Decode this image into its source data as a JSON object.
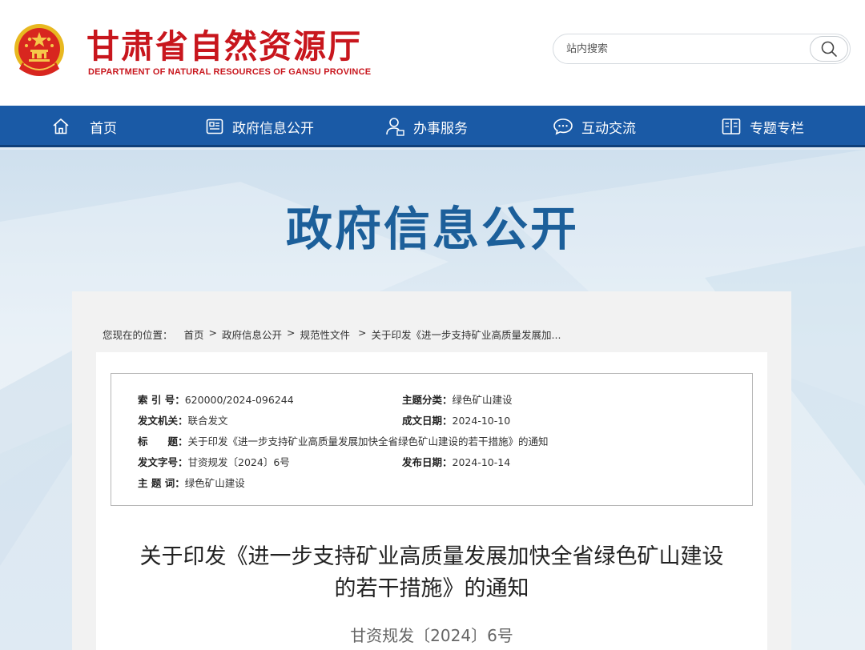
{
  "header": {
    "site_title": "甘肃省自然资源厅",
    "site_subtitle": "DEPARTMENT OF NATURAL RESOURCES OF GANSU PROVINCE",
    "emblem_icon": "national-emblem-icon",
    "search": {
      "placeholder": "站内搜索",
      "value": "",
      "button_icon": "search-icon"
    }
  },
  "nav": {
    "items": [
      {
        "label": "首页",
        "icon": "home-icon"
      },
      {
        "label": "政府信息公开",
        "icon": "document-icon"
      },
      {
        "label": "办事服务",
        "icon": "user-service-icon"
      },
      {
        "label": "互动交流",
        "icon": "chat-icon"
      },
      {
        "label": "专题专栏",
        "icon": "book-icon"
      }
    ]
  },
  "banner": {
    "title": "政府信息公开"
  },
  "breadcrumb": {
    "prefix": "您现在的位置：",
    "items": [
      "首页",
      "政府信息公开",
      "规范性文件",
      "关于印发《进一步支持矿业高质量发展加..."
    ]
  },
  "meta": {
    "index_label": "索 引 号：",
    "index_value": "620000/2024-096244",
    "category_label": "主题分类：",
    "category_value": "绿色矿山建设",
    "issuer_label": "发文机关：",
    "issuer_value": "联合发文",
    "date_label": "成文日期：",
    "date_value": "2024-10-10",
    "title_label": "标　　题：",
    "title_value": "关于印发《进一步支持矿业高质量发展加快全省绿色矿山建设的若干措施》的通知",
    "docno_label": "发文字号：",
    "docno_value": "甘资规发〔2024〕6号",
    "publish_label": "发布日期：",
    "publish_value": "2024-10-14",
    "keywords_label": "主 题 词：",
    "keywords_value": "绿色矿山建设"
  },
  "document": {
    "title_line1": "关于印发《进一步支持矿业高质量发展加快全省绿色矿山建设",
    "title_line2": "的若干措施》的通知",
    "number": "甘资规发〔2024〕6号"
  },
  "colors": {
    "brand_red": "#c8161d",
    "nav_blue": "#1a5aa6",
    "banner_title_blue": "#1c5f9a",
    "emblem_gold": "#e8b820"
  }
}
